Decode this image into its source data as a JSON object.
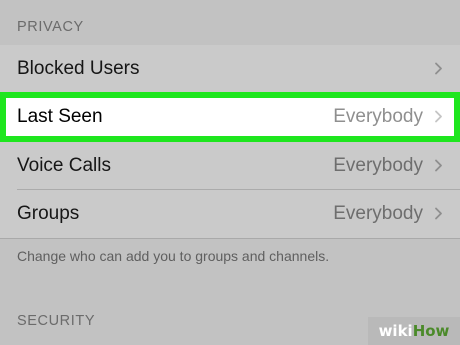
{
  "privacy": {
    "header": "PRIVACY",
    "rows": [
      {
        "label": "Blocked Users",
        "value": ""
      },
      {
        "label": "Last Seen",
        "value": "Everybody"
      },
      {
        "label": "Voice Calls",
        "value": "Everybody"
      },
      {
        "label": "Groups",
        "value": "Everybody"
      }
    ],
    "footer_note": "Change who can add you to groups and channels."
  },
  "security": {
    "header": "SECURITY"
  },
  "watermark": {
    "part1": "wiki",
    "part2": "How"
  },
  "icons": {
    "row_chevron": "chevron-right-icon"
  },
  "colors": {
    "highlight_border": "#1ee61e",
    "background": "#c2c2c2"
  }
}
